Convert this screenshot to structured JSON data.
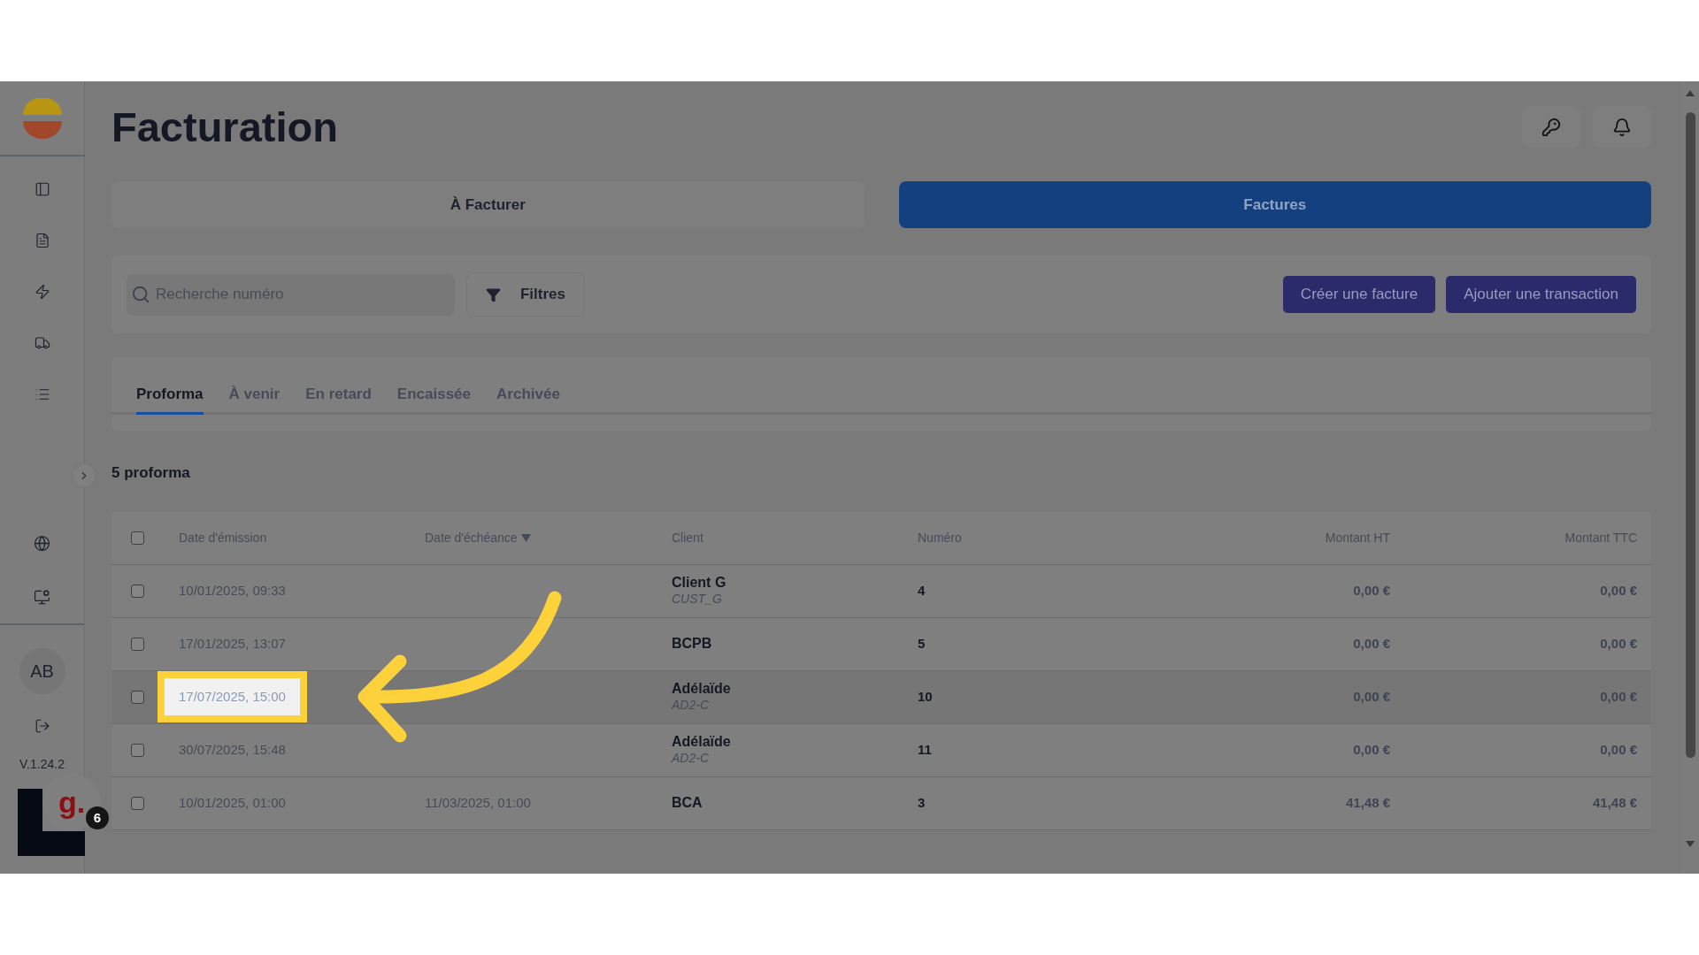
{
  "sidebar": {
    "avatar": "AB",
    "version": "V.1.24.2"
  },
  "help_widget": {
    "logo": "g.",
    "badge": "6"
  },
  "title": "Facturation",
  "view_tabs": [
    {
      "label": "À Facturer",
      "selected": false
    },
    {
      "label": "Factures",
      "selected": true
    }
  ],
  "search": {
    "placeholder": "Recherche numéro"
  },
  "filter_button": "Filtres",
  "actions": [
    "Créer une facture",
    "Ajouter une transaction"
  ],
  "status_tabs": [
    {
      "label": "Proforma",
      "selected": true
    },
    {
      "label": "À venir",
      "selected": false
    },
    {
      "label": "En retard",
      "selected": false
    },
    {
      "label": "Encaissée",
      "selected": false
    },
    {
      "label": "Archivée",
      "selected": false
    }
  ],
  "count": "5 proforma",
  "table": {
    "select_all": false,
    "columns": [
      {
        "label": "Date d'émission"
      },
      {
        "label": "Date d'échéance",
        "sorted": true
      },
      {
        "label": "Client"
      },
      {
        "label": "Numéro"
      },
      {
        "label": "Montant HT"
      },
      {
        "label": "Montant TTC"
      }
    ],
    "rows": [
      {
        "checked": false,
        "highlighted": false,
        "emission": "10/01/2025, 09:33",
        "client": "Client G",
        "client_code": "CUST_G",
        "numero": "4",
        "ht": "0,00 €",
        "ttc": "0,00 €"
      },
      {
        "checked": false,
        "highlighted": false,
        "emission": "17/01/2025, 13:07",
        "client": "BCPB",
        "numero": "5",
        "ht": "0,00 €",
        "ttc": "0,00 €"
      },
      {
        "checked": false,
        "highlighted": true,
        "emission": "17/07/2025, 15:00",
        "client": "Adélaïde",
        "client_code": "AD2-C",
        "numero": "10",
        "ht": "0,00 €",
        "ttc": "0,00 €"
      },
      {
        "checked": false,
        "highlighted": false,
        "emission": "30/07/2025, 15:48",
        "client": "Adélaïde",
        "client_code": "AD2-C",
        "numero": "11",
        "ht": "0,00 €",
        "ttc": "0,00 €"
      },
      {
        "checked": false,
        "highlighted": false,
        "emission": "10/01/2025, 01:00",
        "echeance": "11/03/2025, 01:00",
        "client": "BCA",
        "numero": "3",
        "ht": "41,48 €",
        "ttc": "41,48 €"
      }
    ]
  }
}
